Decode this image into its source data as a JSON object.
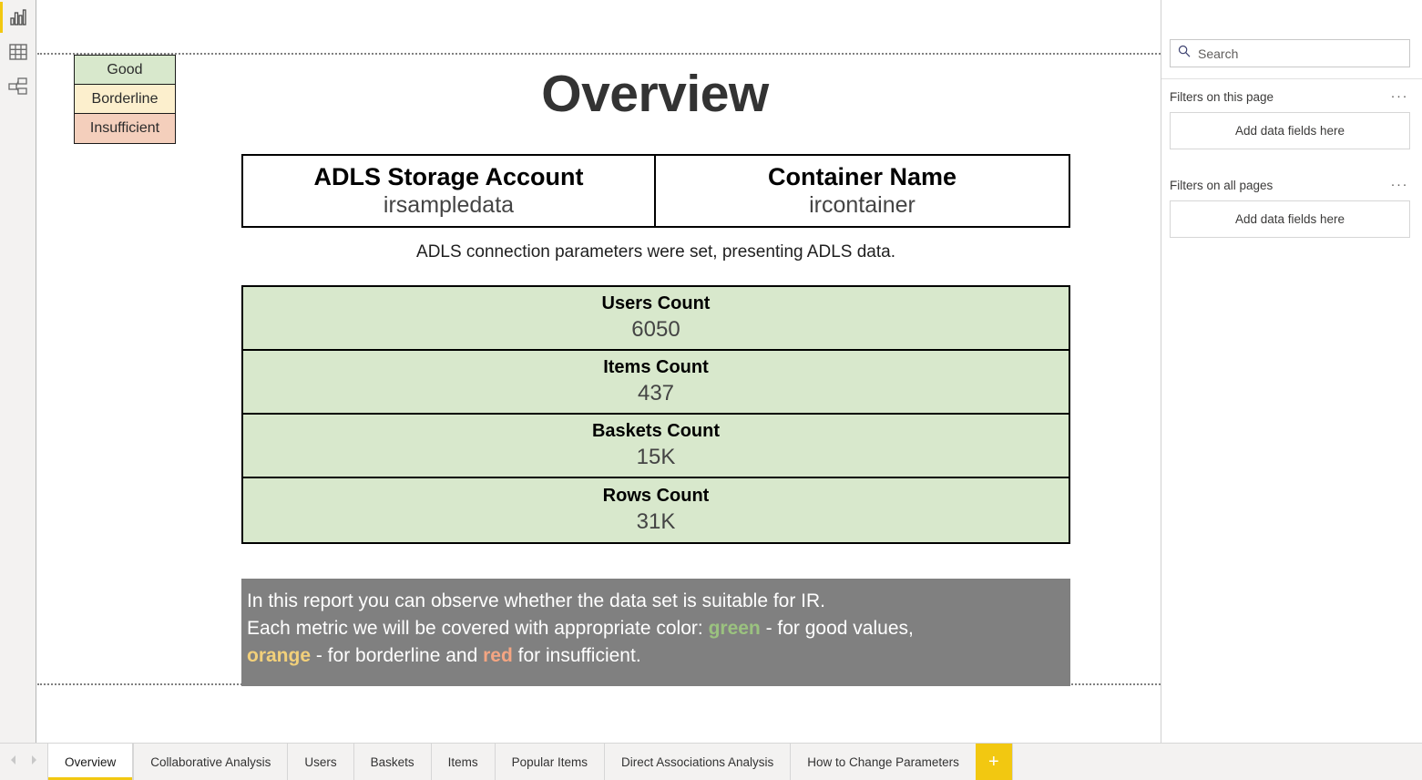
{
  "left_rail": {
    "items": [
      {
        "icon": "report-view-icon",
        "name": "report-view",
        "active": true
      },
      {
        "icon": "table-view-icon",
        "name": "table-view",
        "active": false
      },
      {
        "icon": "model-view-icon",
        "name": "model-view",
        "active": false
      }
    ]
  },
  "legend": {
    "rows": [
      {
        "label": "Good",
        "color": "#d8e8cc"
      },
      {
        "label": "Borderline",
        "color": "#fcefcd"
      },
      {
        "label": "Insufficient",
        "color": "#f4cfbc"
      }
    ]
  },
  "page": {
    "title": "Overview",
    "connection_note": "ADLS connection parameters were set, presenting ADLS data."
  },
  "adls": {
    "cells": [
      {
        "label": "ADLS Storage Account",
        "value": "irsampledata"
      },
      {
        "label": "Container Name",
        "value": "ircontainer"
      }
    ]
  },
  "metrics": [
    {
      "label": "Users Count",
      "value": "6050"
    },
    {
      "label": "Items Count",
      "value": "437"
    },
    {
      "label": "Baskets Count",
      "value": "15K"
    },
    {
      "label": "Rows Count",
      "value": "31K"
    }
  ],
  "description": {
    "background": "#808080",
    "line1": "In this report you can observe whether the data set is suitable for IR.",
    "line2_a": "Each metric we will be covered with appropriate color: ",
    "line2_green": "green",
    "line2_b": " - for good values,",
    "line3_orange": "orange",
    "line3_a": " - for borderline and ",
    "line3_red": "red",
    "line3_b": " for insufficient."
  },
  "filter_pane": {
    "search_placeholder": "Search",
    "search_value": "",
    "groups": [
      {
        "title": "Filters on this page",
        "dropzone": "Add data fields here",
        "menu": "···"
      },
      {
        "title": "Filters on all pages",
        "dropzone": "Add data fields here",
        "menu": "···"
      }
    ]
  },
  "tabbar": {
    "add_label": "+",
    "tabs": [
      {
        "label": "Overview",
        "active": true
      },
      {
        "label": "Collaborative Analysis",
        "active": false
      },
      {
        "label": "Users",
        "active": false
      },
      {
        "label": "Baskets",
        "active": false
      },
      {
        "label": "Items",
        "active": false
      },
      {
        "label": "Popular Items",
        "active": false
      },
      {
        "label": "Direct Associations Analysis",
        "active": false
      },
      {
        "label": "How to Change Parameters",
        "active": false
      }
    ]
  },
  "colors": {
    "accent_yellow": "#f2c811",
    "good_green": "#d8e8cc",
    "borderline_yellow": "#fcefcd",
    "insufficient_peach": "#f4cfbc",
    "desc_gray": "#808080",
    "kw_green": "#9bc27f",
    "kw_orange": "#f2d07a",
    "kw_red": "#f4a582"
  }
}
